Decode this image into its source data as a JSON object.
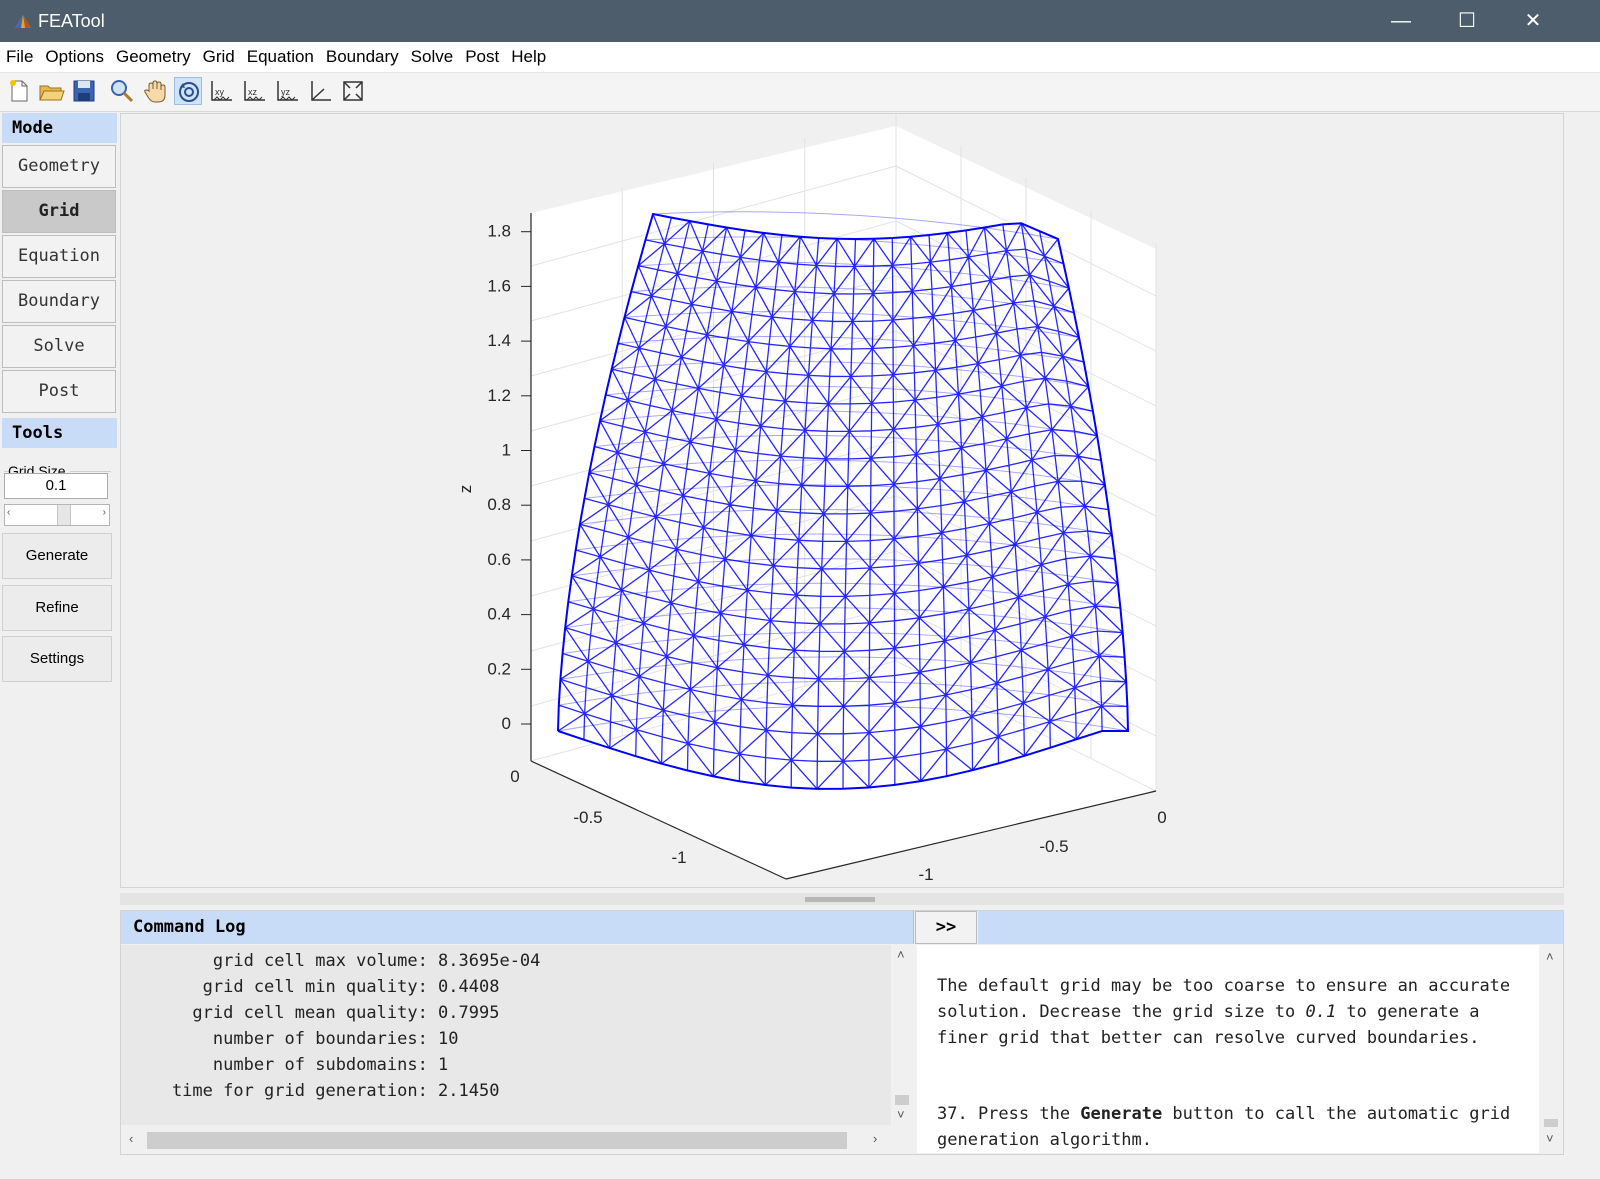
{
  "window": {
    "title": "FEATool",
    "controls": {
      "minimize": "—",
      "maximize": "☐",
      "close": "✕"
    }
  },
  "menu": [
    "File",
    "Options",
    "Geometry",
    "Grid",
    "Equation",
    "Boundary",
    "Solve",
    "Post",
    "Help"
  ],
  "toolbar": {
    "buttons": [
      "new-icon",
      "open-icon",
      "save-icon",
      "zoom-icon",
      "pan-icon",
      "rotate-icon",
      "view-xy-icon",
      "view-xz-icon",
      "view-yz-icon",
      "view-3d-icon",
      "zoom-extents-icon"
    ],
    "active": "rotate-icon"
  },
  "sidebar": {
    "mode_header": "Mode",
    "modes": [
      "Geometry",
      "Grid",
      "Equation",
      "Boundary",
      "Solve",
      "Post"
    ],
    "active_mode": "Grid",
    "tools_header": "Tools",
    "grid_size_label": "Grid Size",
    "grid_size_value": "0.1",
    "slider_arrows": {
      "left": "‹",
      "right": "›"
    },
    "tool_buttons": [
      "Generate",
      "Refine",
      "Settings"
    ]
  },
  "plot": {
    "z_axis_label": "z",
    "z_ticks": [
      "0",
      "0.2",
      "0.4",
      "0.6",
      "0.8",
      "1",
      "1.2",
      "1.4",
      "1.6",
      "1.8"
    ],
    "x_ticks": [
      "0",
      "-0.5",
      "-1"
    ],
    "y_ticks": [
      "0",
      "-0.5",
      "-1"
    ],
    "mesh_color": "#0000ff"
  },
  "log": {
    "header": "Command Log",
    "expand_label": ">>",
    "lines": [
      "        grid cell max volume: 8.3695e-04",
      "       grid cell min quality: 0.4408",
      "      grid cell mean quality: 0.7995",
      "        number of boundaries: 10",
      "        number of subdomains: 1",
      "    time for grid generation: 2.1450"
    ],
    "scroll_arrows": {
      "up": "˄",
      "down": "˅",
      "left": "‹",
      "right": "›"
    }
  },
  "instructions": {
    "p1_start": "The default grid may be too coarse to ensure an accurate solution. Decrease the grid size to ",
    "p1_value": "0.1",
    "p1_end": " to generate a finer grid that better can resolve curved boundaries.",
    "p2_start": "37. Press the ",
    "p2_bold": "Generate",
    "p2_end": " button to call the automatic grid generation algorithm."
  }
}
